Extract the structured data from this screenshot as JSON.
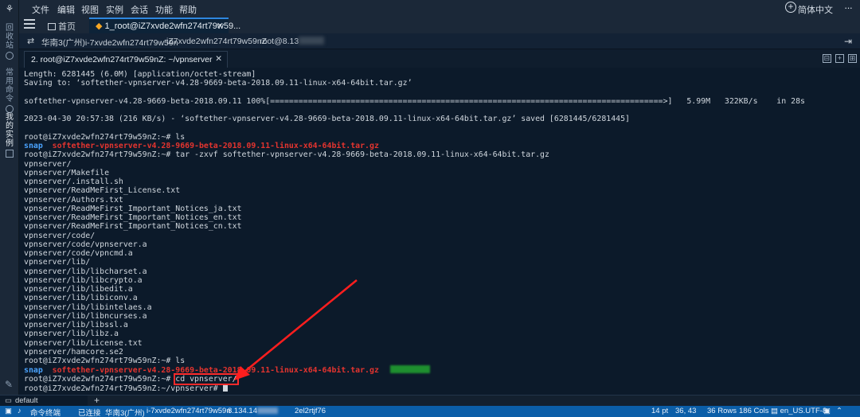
{
  "menubar": {
    "items": [
      "文件",
      "编辑",
      "视图",
      "实例",
      "会话",
      "功能",
      "帮助"
    ],
    "language": "简体中文"
  },
  "sidebar": {
    "tabs": [
      {
        "label": "回收站"
      },
      {
        "label": "常用命令"
      },
      {
        "label": "我的实例"
      }
    ]
  },
  "session_tabs": {
    "home": "首页",
    "active": "1_root@iZ7xvde2wfn274rt79w59..."
  },
  "connection": {
    "region": "华南3(广州)i-7xvde2wfn274rt79w59n",
    "host": "iZ7xvde2wfn274rt79w59nZ",
    "user_ip": "root@8.13"
  },
  "terminal_tab": {
    "label": "2. root@iZ7xvde2wfn274rt79w59nZ: ~/vpnserver"
  },
  "terminal": {
    "lines": [
      [
        {
          "t": "Length: 6281445 (6.0M) [application/octet-stream]"
        }
      ],
      [
        {
          "t": "Saving to: ‘softether-vpnserver-v4.28-9669-beta-2018.09.11-linux-x64-64bit.tar.gz’"
        }
      ],
      [
        {
          "t": ""
        }
      ],
      [
        {
          "t": "softether-vpnserver-v4.28-9669-beta-2018.09.11 100%[===================================================================================>]   5.99M   322KB/s    in 28s"
        }
      ],
      [
        {
          "t": ""
        }
      ],
      [
        {
          "t": "2023-04-30 20:57:38 (216 KB/s) - ‘softether-vpnserver-v4.28-9669-beta-2018.09.11-linux-x64-64bit.tar.gz’ saved [6281445/6281445]"
        }
      ],
      [
        {
          "t": ""
        }
      ],
      [
        {
          "t": "root@iZ7xvde2wfn274rt79w59nZ:~# ls"
        }
      ],
      [
        {
          "t": "snap",
          "c": "blue"
        },
        {
          "t": "  "
        },
        {
          "t": "softether-vpnserver-v4.28-9669-beta-2018.09.11-linux-x64-64bit.tar.gz",
          "c": "red"
        }
      ],
      [
        {
          "t": "root@iZ7xvde2wfn274rt79w59nZ:~# tar -zxvf softether-vpnserver-v4.28-9669-beta-2018.09.11-linux-x64-64bit.tar.gz"
        }
      ],
      [
        {
          "t": "vpnserver/"
        }
      ],
      [
        {
          "t": "vpnserver/Makefile"
        }
      ],
      [
        {
          "t": "vpnserver/.install.sh"
        }
      ],
      [
        {
          "t": "vpnserver/ReadMeFirst_License.txt"
        }
      ],
      [
        {
          "t": "vpnserver/Authors.txt"
        }
      ],
      [
        {
          "t": "vpnserver/ReadMeFirst_Important_Notices_ja.txt"
        }
      ],
      [
        {
          "t": "vpnserver/ReadMeFirst_Important_Notices_en.txt"
        }
      ],
      [
        {
          "t": "vpnserver/ReadMeFirst_Important_Notices_cn.txt"
        }
      ],
      [
        {
          "t": "vpnserver/code/"
        }
      ],
      [
        {
          "t": "vpnserver/code/vpnserver.a"
        }
      ],
      [
        {
          "t": "vpnserver/code/vpncmd.a"
        }
      ],
      [
        {
          "t": "vpnserver/lib/"
        }
      ],
      [
        {
          "t": "vpnserver/lib/libcharset.a"
        }
      ],
      [
        {
          "t": "vpnserver/lib/libcrypto.a"
        }
      ],
      [
        {
          "t": "vpnserver/lib/libedit.a"
        }
      ],
      [
        {
          "t": "vpnserver/lib/libiconv.a"
        }
      ],
      [
        {
          "t": "vpnserver/lib/libintelaes.a"
        }
      ],
      [
        {
          "t": "vpnserver/lib/libncurses.a"
        }
      ],
      [
        {
          "t": "vpnserver/lib/libssl.a"
        }
      ],
      [
        {
          "t": "vpnserver/lib/libz.a"
        }
      ],
      [
        {
          "t": "vpnserver/lib/License.txt"
        }
      ],
      [
        {
          "t": "vpnserver/hamcore.se2"
        }
      ],
      [
        {
          "t": "root@iZ7xvde2wfn274rt79w59nZ:~# ls"
        }
      ],
      [
        {
          "t": "snap",
          "c": "blue"
        },
        {
          "t": "  "
        },
        {
          "t": "softether-vpnserver-v4.28-9669-beta-2018.09.11-linux-x64-64bit.tar.gz",
          "c": "red"
        },
        {
          "t": "",
          "c": "greenblur"
        }
      ],
      [
        {
          "t": "root@iZ7xvde2wfn274rt79w59nZ:~# "
        },
        {
          "t": "cd vpnserver/",
          "c": "hl"
        }
      ],
      [
        {
          "t": "root@iZ7xvde2wfn274rt79w59nZ:~/vpnserver# "
        },
        {
          "t": "",
          "c": "cursor"
        }
      ]
    ]
  },
  "bottom": {
    "tab": "default"
  },
  "statusbar": {
    "items": [
      {
        "label": "命令终端"
      },
      {
        "label": "已连接"
      },
      {
        "label": "华南3(广州)"
      },
      {
        "label": "i-7xvde2wfn274rt79w59n"
      },
      {
        "label": "8.134.14"
      },
      {
        "label": "2el2rtjf76"
      },
      {
        "label": "14 pt"
      },
      {
        "label": "36, 43"
      },
      {
        "label": "36 Rows"
      },
      {
        "label": "186 Cols"
      },
      {
        "label": "en_US.UTF-8"
      }
    ]
  }
}
